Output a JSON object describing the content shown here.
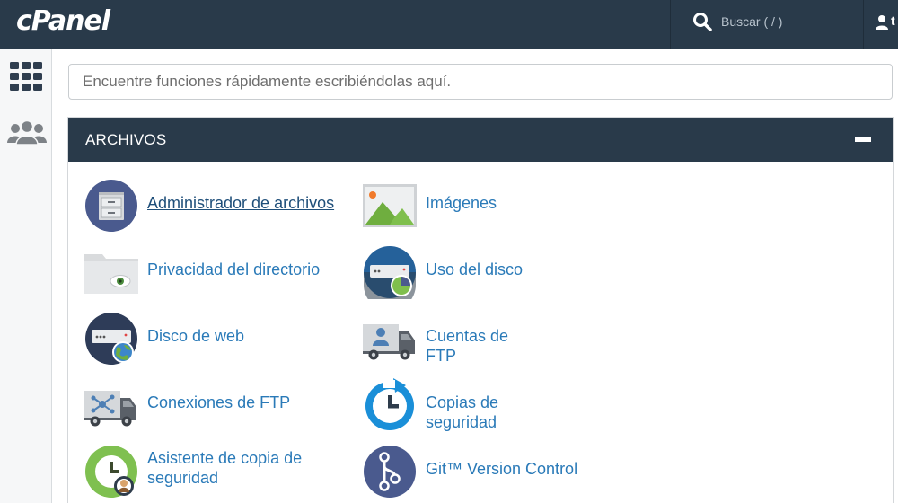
{
  "header": {
    "logo": "cPanel",
    "search_label": "Buscar ( / )",
    "user_label": "t"
  },
  "quick_search": {
    "placeholder": "Encuentre funciones rápidamente escribiéndolas aquí."
  },
  "panel": {
    "title": "ARCHIVOS",
    "items": [
      {
        "label": "Administrador de archivos",
        "icon": "file-manager-icon"
      },
      {
        "label": "Imágenes",
        "icon": "images-icon"
      },
      {
        "label": "Privacidad del directorio",
        "icon": "directory-privacy-icon"
      },
      {
        "label": "Uso del disco",
        "icon": "disk-usage-icon"
      },
      {
        "label": "Disco de web",
        "icon": "web-disk-icon"
      },
      {
        "label": "Cuentas de FTP",
        "icon": "ftp-accounts-icon"
      },
      {
        "label": "Conexiones de FTP",
        "icon": "ftp-connections-icon"
      },
      {
        "label": "Copias de seguridad",
        "icon": "backup-icon"
      },
      {
        "label": "Asistente de copia de seguridad",
        "label_line1": "Asistente de copia de",
        "label_line2": "seguridad",
        "icon": "backup-wizard-icon"
      },
      {
        "label": "Git™ Version Control",
        "icon": "git-version-control-icon"
      }
    ]
  },
  "colors": {
    "topbar": "#293a4a",
    "link": "#2a7ab8",
    "icon_navy": "#4a5a8e",
    "icon_blue": "#1a8fd8",
    "icon_green": "#7fc050"
  }
}
